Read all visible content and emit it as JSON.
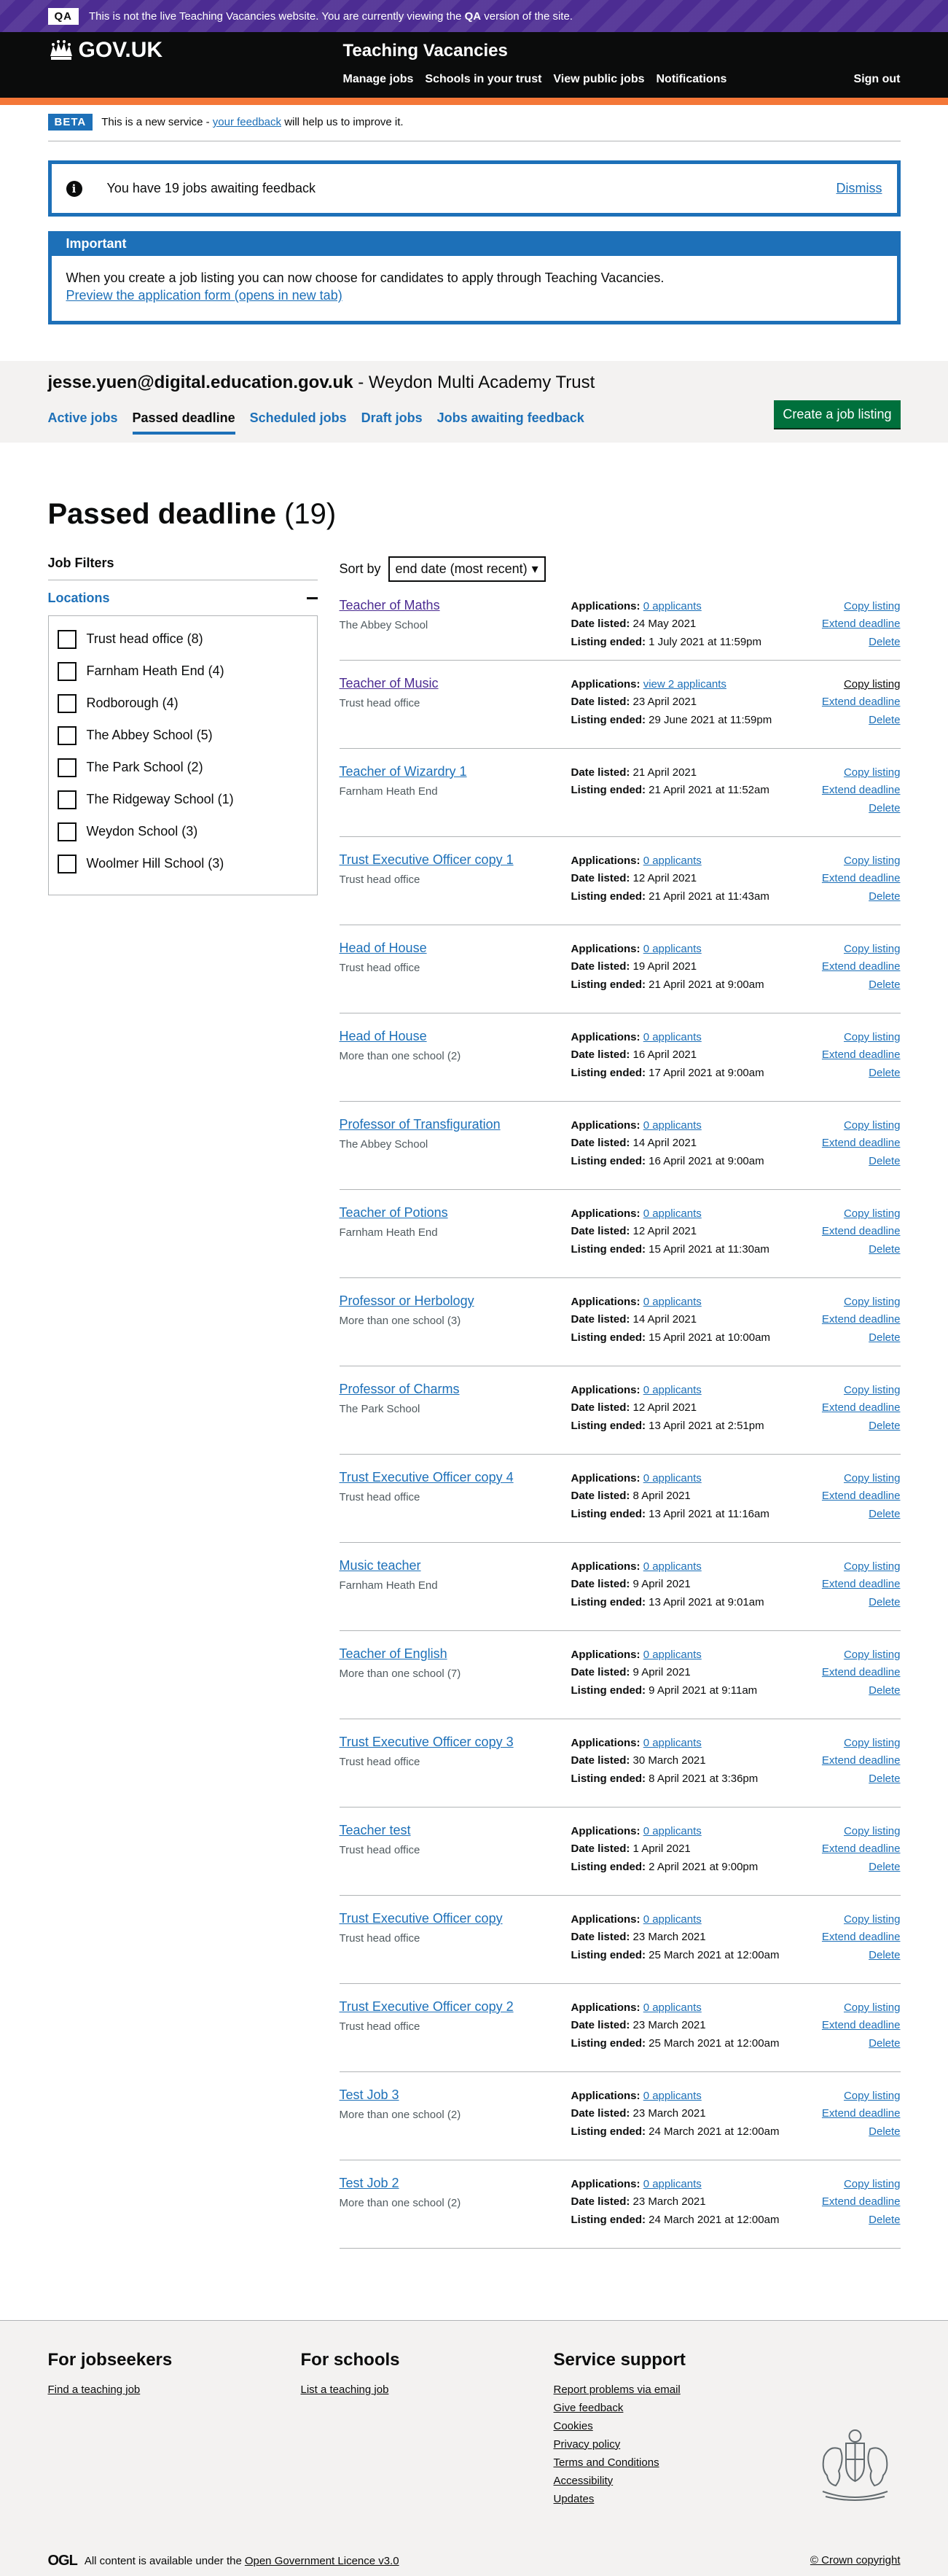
{
  "qa_banner": {
    "tag": "QA",
    "text_before": "This is not the live Teaching Vacancies website. You are currently viewing the",
    "env": "QA",
    "text_after": "version of the site."
  },
  "header": {
    "logo": "GOV.UK",
    "service_name": "Teaching Vacancies",
    "nav": [
      "Manage jobs",
      "Schools in your trust",
      "View public jobs",
      "Notifications"
    ],
    "sign_out": "Sign out",
    "accent_color": "#f47738"
  },
  "phase_banner": {
    "tag": "BETA",
    "text_before": "This is a new service -",
    "link": "your feedback",
    "text_after": "will help us to improve it."
  },
  "notice": {
    "text": "You have 19 jobs awaiting feedback",
    "dismiss": "Dismiss",
    "icon": "info-icon"
  },
  "important": {
    "title": "Important",
    "body": "When you create a job listing you can now choose for candidates to apply through Teaching Vacancies.",
    "link": "Preview the application form (opens in new tab)"
  },
  "account": {
    "email": "jesse.yuen@digital.education.gov.uk",
    "organisation": "- Weydon Multi Academy Trust",
    "tabs": [
      {
        "label": "Active jobs",
        "active": false
      },
      {
        "label": "Passed deadline",
        "active": true
      },
      {
        "label": "Scheduled jobs",
        "active": false
      },
      {
        "label": "Draft jobs",
        "active": false
      },
      {
        "label": "Jobs awaiting feedback",
        "active": false
      }
    ],
    "create_button": "Create a job listing"
  },
  "page": {
    "title": "Passed deadline",
    "count": "(19)"
  },
  "filters": {
    "title": "Job Filters",
    "locations_heading": "Locations",
    "options": [
      "Trust head office (8)",
      "Farnham Heath End (4)",
      "Rodborough (4)",
      "The Abbey School (5)",
      "The Park School (2)",
      "The Ridgeway School (1)",
      "Weydon School (3)",
      "Woolmer Hill School (3)"
    ]
  },
  "sort": {
    "label": "Sort by",
    "selected": "end date (most recent)"
  },
  "labels": {
    "applications": "Applications:",
    "date_listed": "Date listed:",
    "listing_ended": "Listing ended:",
    "copy": "Copy listing",
    "extend": "Extend deadline",
    "delete": "Delete"
  },
  "jobs": [
    {
      "title": "Teacher of Maths",
      "location": "The Abbey School",
      "applications": "0 applicants",
      "date_listed": "24 May 2021",
      "listing_ended": "1 July 2021 at 11:59pm",
      "visited": true
    },
    {
      "title": "Teacher of Music",
      "location": "Trust head office",
      "applications": "view 2 applicants",
      "date_listed": "23 April 2021",
      "listing_ended": "29 June 2021 at 11:59pm",
      "visited": true
    },
    {
      "title": "Teacher of Wizardry 1",
      "location": "Farnham Heath End",
      "applications": null,
      "date_listed": "21 April 2021",
      "listing_ended": "21 April 2021 at 11:52am",
      "visited": false
    },
    {
      "title": "Trust Executive Officer copy 1",
      "location": "Trust head office",
      "applications": "0 applicants",
      "date_listed": "12 April 2021",
      "listing_ended": "21 April 2021 at 11:43am",
      "visited": false
    },
    {
      "title": "Head of House",
      "location": "Trust head office",
      "applications": "0 applicants",
      "date_listed": "19 April 2021",
      "listing_ended": "21 April 2021 at 9:00am",
      "visited": false
    },
    {
      "title": "Head of House",
      "location": "More than one school (2)",
      "applications": "0 applicants",
      "date_listed": "16 April 2021",
      "listing_ended": "17 April 2021 at 9:00am",
      "visited": false
    },
    {
      "title": "Professor of Transfiguration",
      "location": "The Abbey School",
      "applications": "0 applicants",
      "date_listed": "14 April 2021",
      "listing_ended": "16 April 2021 at 9:00am",
      "visited": false
    },
    {
      "title": "Teacher of Potions",
      "location": "Farnham Heath End",
      "applications": "0 applicants",
      "date_listed": "12 April 2021",
      "listing_ended": "15 April 2021 at 11:30am",
      "visited": false
    },
    {
      "title": "Professor or Herbology",
      "location": "More than one school (3)",
      "applications": "0 applicants",
      "date_listed": "14 April 2021",
      "listing_ended": "15 April 2021 at 10:00am",
      "visited": false
    },
    {
      "title": "Professor of Charms",
      "location": "The Park School",
      "applications": "0 applicants",
      "date_listed": "12 April 2021",
      "listing_ended": "13 April 2021 at 2:51pm",
      "visited": false
    },
    {
      "title": "Trust Executive Officer copy 4",
      "location": "Trust head office",
      "applications": "0 applicants",
      "date_listed": "8 April 2021",
      "listing_ended": "13 April 2021 at 11:16am",
      "visited": false
    },
    {
      "title": "Music teacher",
      "location": "Farnham Heath End",
      "applications": "0 applicants",
      "date_listed": "9 April 2021",
      "listing_ended": "13 April 2021 at 9:01am",
      "visited": false
    },
    {
      "title": "Teacher of English",
      "location": "More than one school (7)",
      "applications": "0 applicants",
      "date_listed": "9 April 2021",
      "listing_ended": "9 April 2021 at 9:11am",
      "visited": false
    },
    {
      "title": "Trust Executive Officer copy 3",
      "location": "Trust head office",
      "applications": "0 applicants",
      "date_listed": "30 March 2021",
      "listing_ended": "8 April 2021 at 3:36pm",
      "visited": false
    },
    {
      "title": "Teacher test",
      "location": "Trust head office",
      "applications": "0 applicants",
      "date_listed": "1 April 2021",
      "listing_ended": "2 April 2021 at 9:00pm",
      "visited": false
    },
    {
      "title": "Trust Executive Officer copy",
      "location": "Trust head office",
      "applications": "0 applicants",
      "date_listed": "23 March 2021",
      "listing_ended": "25 March 2021 at 12:00am",
      "visited": false
    },
    {
      "title": "Trust Executive Officer copy 2",
      "location": "Trust head office",
      "applications": "0 applicants",
      "date_listed": "23 March 2021",
      "listing_ended": "25 March 2021 at 12:00am",
      "visited": false
    },
    {
      "title": "Test Job 3",
      "location": "More than one school (2)",
      "applications": "0 applicants",
      "date_listed": "23 March 2021",
      "listing_ended": "24 March 2021 at 12:00am",
      "visited": false
    },
    {
      "title": "Test Job 2",
      "location": "More than one school (2)",
      "applications": "0 applicants",
      "date_listed": "23 March 2021",
      "listing_ended": "24 March 2021 at 12:00am",
      "visited": false
    }
  ],
  "footer": {
    "jobseekers": {
      "title": "For jobseekers",
      "links": [
        "Find a teaching job"
      ]
    },
    "schools": {
      "title": "For schools",
      "links": [
        "List a teaching job"
      ]
    },
    "support": {
      "title": "Service support",
      "links": [
        "Report problems via email",
        "Give feedback",
        "Cookies",
        "Privacy policy",
        "Terms and Conditions",
        "Accessibility",
        "Updates"
      ]
    },
    "ogl_mark": "OGL",
    "licence_text": "All content is available under the",
    "licence_link": "Open Government Licence v3.0",
    "copyright": "© Crown copyright"
  }
}
